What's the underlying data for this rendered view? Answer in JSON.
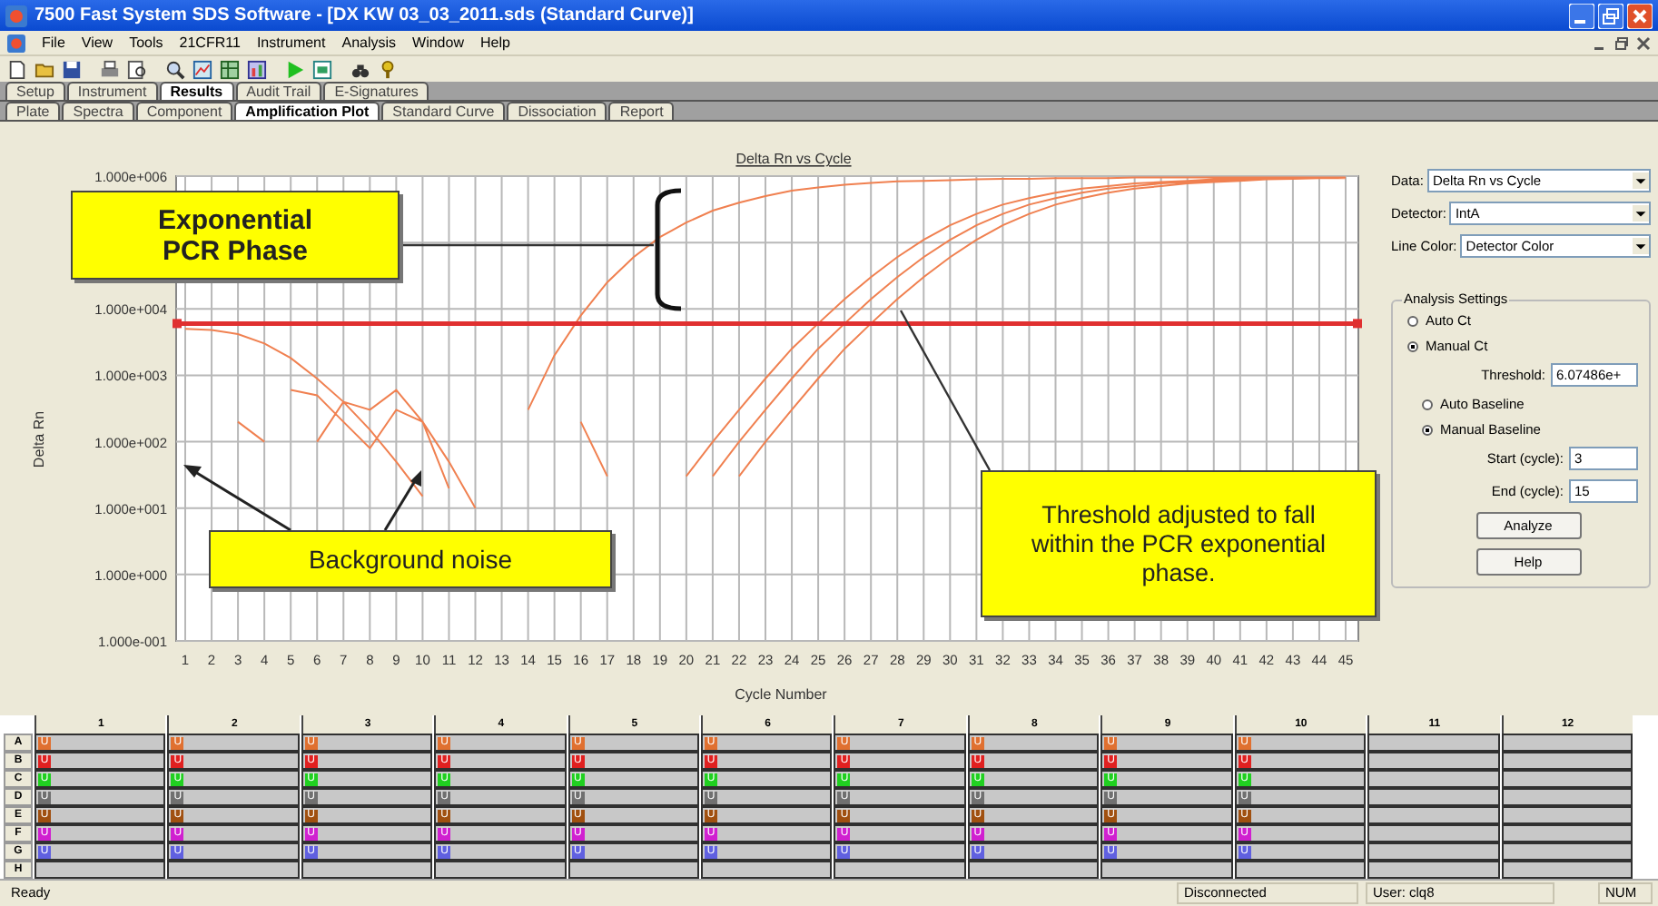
{
  "window": {
    "title": "7500 Fast System SDS Software - [DX KW 03_03_2011.sds (Standard Curve)]"
  },
  "menu": [
    "File",
    "View",
    "Tools",
    "21CFR11",
    "Instrument",
    "Analysis",
    "Window",
    "Help"
  ],
  "tabs": [
    {
      "label": "Setup",
      "selected": false
    },
    {
      "label": "Instrument",
      "selected": false
    },
    {
      "label": "Results",
      "selected": true
    },
    {
      "label": "Audit Trail",
      "selected": false
    },
    {
      "label": "E-Signatures",
      "selected": false
    }
  ],
  "subtabs": [
    {
      "label": "Plate",
      "selected": false
    },
    {
      "label": "Spectra",
      "selected": false
    },
    {
      "label": "Component",
      "selected": false
    },
    {
      "label": "Amplification Plot",
      "selected": true
    },
    {
      "label": "Standard Curve",
      "selected": false
    },
    {
      "label": "Dissociation",
      "selected": false
    },
    {
      "label": "Report",
      "selected": false
    }
  ],
  "chart": {
    "title": "Delta Rn vs Cycle",
    "xlabel": "Cycle Number",
    "ylabel": "Delta Rn",
    "x_labels": [
      "1",
      "2",
      "3",
      "4",
      "5",
      "6",
      "7",
      "8",
      "9",
      "10",
      "11",
      "12",
      "13",
      "14",
      "15",
      "16",
      "17",
      "18",
      "19",
      "20",
      "21",
      "22",
      "23",
      "24",
      "25",
      "26",
      "27",
      "28",
      "29",
      "30",
      "31",
      "32",
      "33",
      "34",
      "35",
      "36",
      "37",
      "38",
      "39",
      "40",
      "41",
      "42",
      "43",
      "44",
      "45"
    ],
    "y_labels": [
      "1.000e+006",
      "1.000e+004",
      "1.000e+003",
      "1.000e+002",
      "1.000e+001",
      "1.000e+000",
      "1.000e-001"
    ]
  },
  "callouts": [
    {
      "text": "Exponential PCR Phase"
    },
    {
      "text": "Background noise"
    },
    {
      "text": "Threshold adjusted to fall within the PCR exponential phase."
    }
  ],
  "panel": {
    "fields": [
      {
        "label": "Data:",
        "value": "Delta Rn vs Cycle"
      },
      {
        "label": "Detector:",
        "value": "IntA"
      },
      {
        "label": "Line Color:",
        "value": "Detector Color"
      }
    ],
    "analysis": {
      "title": "Analysis Settings",
      "ct_options": [
        {
          "label": "Auto Ct",
          "selected": false
        },
        {
          "label": "Manual Ct",
          "selected": true
        }
      ],
      "threshold": {
        "label": "Threshold:",
        "value": "6.07486e+"
      },
      "baseline_options": [
        {
          "label": "Auto Baseline",
          "selected": false
        },
        {
          "label": "Manual Baseline",
          "selected": true
        }
      ],
      "start": {
        "label": "Start (cycle):",
        "value": "3"
      },
      "end": {
        "label": "End (cycle):",
        "value": "15"
      },
      "buttons": [
        "Analyze",
        "Help"
      ]
    }
  },
  "plate": {
    "columns": [
      "1",
      "2",
      "3",
      "4",
      "5",
      "6",
      "7",
      "8",
      "9",
      "10",
      "11",
      "12"
    ],
    "rows": [
      {
        "label": "A",
        "color": "#e07030",
        "wells": [
          "U",
          "U",
          "U",
          "U",
          "U",
          "U",
          "U",
          "U",
          "U",
          "U"
        ]
      },
      {
        "label": "B",
        "color": "#e02020",
        "wells": [
          "U",
          "U",
          "U",
          "U",
          "U",
          "U",
          "U",
          "U",
          "U",
          "U"
        ]
      },
      {
        "label": "C",
        "color": "#20d020",
        "wells": [
          "U",
          "U",
          "U",
          "U",
          "U",
          "U",
          "U",
          "U",
          "U",
          "U"
        ]
      },
      {
        "label": "D",
        "color": "#707070",
        "wells": [
          "U",
          "U",
          "U",
          "U",
          "U",
          "U",
          "U",
          "U",
          "U",
          "U"
        ]
      },
      {
        "label": "E",
        "color": "#a05010",
        "wells": [
          "U",
          "U",
          "U",
          "U",
          "U",
          "U",
          "U",
          "U",
          "U",
          "U"
        ]
      },
      {
        "label": "F",
        "color": "#d020d0",
        "wells": [
          "U",
          "U",
          "U",
          "U",
          "U",
          "U",
          "U",
          "U",
          "U",
          "U"
        ]
      },
      {
        "label": "G",
        "color": "#6060e0",
        "wells": [
          "U",
          "U",
          "U",
          "U",
          "U",
          "U",
          "U",
          "U",
          "U",
          "U"
        ]
      },
      {
        "label": "H"
      }
    ]
  },
  "status_bar": [
    "Ready",
    "Disconnected",
    "User: clq8",
    "NUM"
  ]
}
